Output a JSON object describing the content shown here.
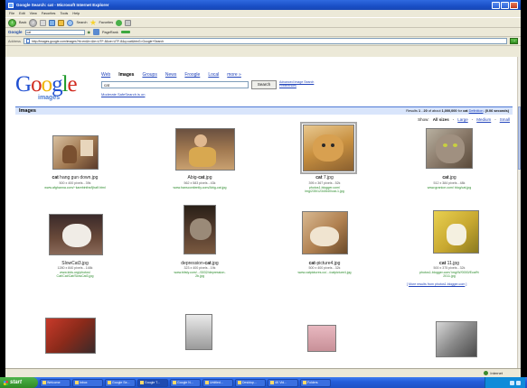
{
  "window": {
    "title": "Google Search: cat - Microsoft Internet Explorer",
    "menu": [
      "File",
      "Edit",
      "View",
      "Favorites",
      "Tools",
      "Help"
    ]
  },
  "toolbar": {
    "back_label": "Back",
    "search_label": "Search",
    "favorites_label": "Favorites"
  },
  "googlebar": {
    "logo": "Google",
    "query": "cat",
    "pagerank_label": "PageRank"
  },
  "addressbar": {
    "label": "Address",
    "url": "http://images.google.com/images?hl=en&lr=&ie=UTF-8&oe=UTF-8&q=cat&btnG=Google+Search"
  },
  "google": {
    "logo_letters": [
      "G",
      "o",
      "o",
      "g",
      "l",
      "e"
    ],
    "logo_colors": [
      "#1f4fd1",
      "#d12b1f",
      "#f0b400",
      "#1f4fd1",
      "#1e9a2a",
      "#d12b1f"
    ],
    "images_sub": "images",
    "tabs": [
      "Web",
      "Images",
      "Groups",
      "News",
      "Froogle",
      "Local",
      "more »"
    ],
    "active_tab": "Images",
    "search_value": "cat",
    "search_button": "Search",
    "advanced_search": "Advanced Image Search",
    "preferences": "Preferences",
    "safe_search": "Moderate SafeSearch is on",
    "bar_title": "Images",
    "results": {
      "prefix": "Results",
      "range_start": "1",
      "range_end": "20",
      "of_about": "of about",
      "total": "1,000,000",
      "for": "for",
      "query": "cat",
      "definition": "Definition",
      "time": "(0.06 seconds)"
    },
    "show": {
      "label": "Show:",
      "all_sizes": "All sizes",
      "large": "Large",
      "medium": "Medium",
      "small": "Small"
    },
    "images": [
      {
        "prefix": "",
        "bold": "cat",
        "suffix": " hang gun down.jpg",
        "meta": "500 x 400 pixels - 39k",
        "url": "www.afghanna.com/~karebinthe/ljhalf.html",
        "color": "#b48a6a"
      },
      {
        "prefix": "Abig-",
        "bold": "cat",
        "suffix": ".jpg",
        "meta": "562 x 583 pixels - 43k",
        "url": "www.hanscontiently.com/Abig-cat.jpg",
        "color": "#8a6a4a"
      },
      {
        "prefix": "",
        "bold": "cat",
        "suffix": " 7.jpg",
        "meta": "395 x 367 pixels - 52k",
        "url": "photos1.blogger.com/\nimg/235/1234/640/cat-1.jpg",
        "color": "#c89a5a"
      },
      {
        "prefix": "",
        "bold": "cat",
        "suffix": ".jpg",
        "meta": "512 x 384 pixels - 48k",
        "url": "www.granice.com/ blog/cat.jpg",
        "color": "#9a8a7a"
      },
      {
        "prefix": "SlowCat3.jpg",
        "bold": "",
        "suffix": "",
        "meta": "1280 x 840 pixels - 148k",
        "url": "www.kids.org/photos/\nCat/Cat/Cat/SlowCat3.jpg",
        "color": "#7a6a6a"
      },
      {
        "prefix": "depression-",
        "bold": "cat",
        "suffix": ".jpg",
        "meta": "323 x 400 pixels - 19k",
        "url": "www.bitsly.com/.../3032/depression-\n2b.jpg",
        "color": "#6a5a4a"
      },
      {
        "prefix": "",
        "bold": "cat",
        "suffix": "-picture4.jpg",
        "meta": "500 x 400 pixels - 32k",
        "url": "www.catpictures.co/.../catpicture4.jpg",
        "color": "#a88a5a"
      },
      {
        "prefix": "",
        "bold": "cat",
        "suffix": " 11.jpg",
        "meta": "500 x 375 pixels - 32k",
        "url": "photos1.blogger.com/ img/W/0000/Ecat%\n2011.jpg",
        "color": "#c8a83a"
      }
    ],
    "more_results": {
      "open": "[",
      "text": "More results from photos1.blogger.com",
      "close": "]"
    }
  },
  "status": {
    "zone": "Internet"
  },
  "taskbar": {
    "start": "start",
    "tasks": [
      "Welcome",
      "Inbox",
      "Google Se...",
      "Google T...",
      "Google N...",
      "Untitled...",
      "Desktop...",
      "4K Vid...",
      "Folders"
    ],
    "active_index": 3,
    "clock": ""
  }
}
